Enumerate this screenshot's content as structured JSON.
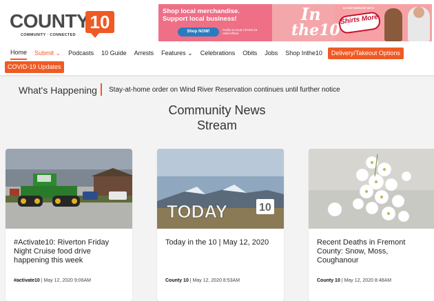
{
  "logo": {
    "name": "COUNTY",
    "number": "10",
    "tagline": "COMMUNITY · CONNECTED"
  },
  "banner": {
    "headline": "Shop local merchandise. Support local business!",
    "button": "Shop NOW!",
    "small_text": "Profits to local COVID-19 relief efforts",
    "in_text": "In",
    "the10_text": "the10",
    "partner_text": "IN PARTNERSHIP WITH",
    "shirts_text": "Shirts More"
  },
  "nav": {
    "items": [
      {
        "label": "Home",
        "active": true
      },
      {
        "label": "Submit ⌄",
        "orange": true
      },
      {
        "label": "Podcasts"
      },
      {
        "label": "10 Guide"
      },
      {
        "label": "Arrests"
      },
      {
        "label": "Features ⌄"
      },
      {
        "label": "Celebrations"
      },
      {
        "label": "Obits"
      },
      {
        "label": "Jobs"
      },
      {
        "label": "Shop Inthe10"
      }
    ],
    "delivery_button": "Delivery/Takeout Options",
    "covid_button": "COVID-19 Updates"
  },
  "whats_happening": {
    "label": "What's Happening",
    "headline": "Stay-at-home order on Wind River Reservation continues until further notice"
  },
  "stream": {
    "title_line1": "Community News",
    "title_line2": "Stream"
  },
  "cards": [
    {
      "title": "#Activate10: Riverton Friday Night Cruise food drive happening this week",
      "author": "#activate10",
      "date": "May 12, 2020 9:06AM"
    },
    {
      "title": "Today in the 10 | May 12, 2020",
      "author": "County 10",
      "date": "May 12, 2020 8:53AM",
      "image_text": "TODAY",
      "image_badge": "10"
    },
    {
      "title": "Recent Deaths in Fremont County: Snow, Moss, Coughanour",
      "author": "County 10",
      "date": "May 12, 2020 8:48AM"
    }
  ],
  "colors": {
    "accent": "#ef5a24",
    "background": "#f3f3f3"
  }
}
